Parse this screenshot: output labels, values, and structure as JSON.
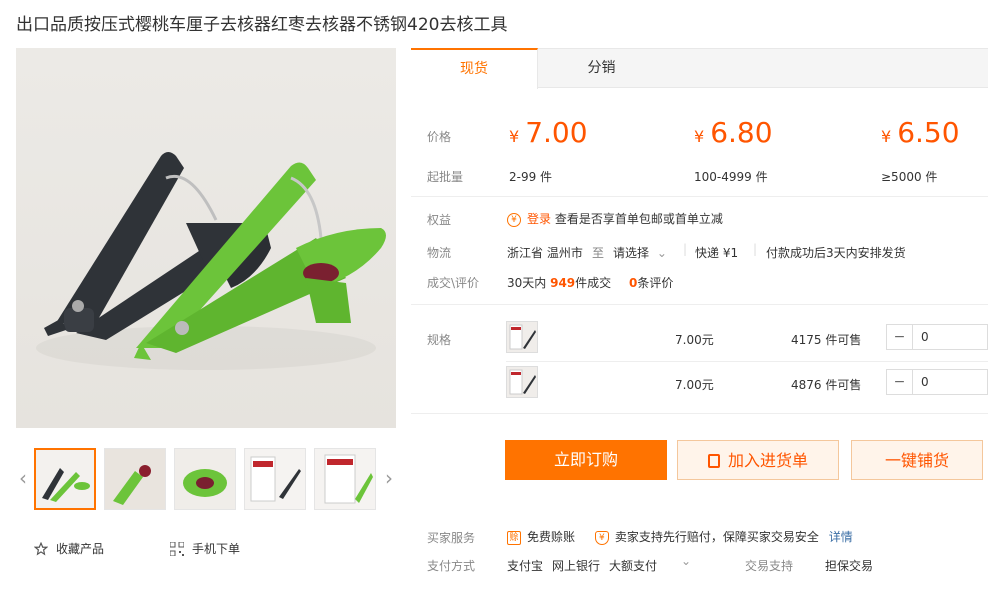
{
  "title": "出口品质按压式樱桃车厘子去核器红枣去核器不锈钢420去核工具",
  "gallery": {
    "prev_arrow": "‹",
    "next_arrow": "›",
    "thumb_count": 5,
    "collect_label": "收藏产品",
    "mobile_label": "手机下单"
  },
  "tabs": [
    {
      "label": "现货",
      "active": true
    },
    {
      "label": "分销",
      "active": false
    }
  ],
  "pricing": {
    "price_label": "价格",
    "moq_label": "起批量",
    "currency": "¥",
    "tiers": [
      {
        "price": "7.00",
        "range": "2-99 件"
      },
      {
        "price": "6.80",
        "range": "100-4999 件"
      },
      {
        "price": "6.50",
        "range": "≥5000 件"
      }
    ]
  },
  "benefits": {
    "label": "权益",
    "login": "登录",
    "text": "查看是否享首单包邮或首单立减"
  },
  "logistics": {
    "label": "物流",
    "origin": "浙江省 温州市",
    "to": "至",
    "dest_placeholder": "请选择",
    "express": "快递 ¥1",
    "ship_note": "付款成功后3天内安排发货"
  },
  "deals": {
    "label": "成交\\评价",
    "prefix": "30天内",
    "count": "949",
    "suffix": "件成交",
    "reviews_count": "0",
    "reviews_suffix": "条评价"
  },
  "specs": {
    "label": "规格",
    "rows": [
      {
        "price": "7.00元",
        "stock": "4175 件可售",
        "qty": "0"
      },
      {
        "price": "7.00元",
        "stock": "4876 件可售",
        "qty": "0"
      }
    ]
  },
  "buttons": {
    "buy": "立即订购",
    "add_cart": "加入进货单",
    "dist": "一键铺货"
  },
  "services": {
    "label": "买家服务",
    "free_refund": "免费赊账",
    "guarantee": "卖家支持先行赔付，保障买家交易安全",
    "detail": "详情"
  },
  "payment": {
    "label": "支付方式",
    "methods": [
      "支付宝",
      "网上银行",
      "大额支付"
    ],
    "trade_label": "交易支持",
    "trade_value": "担保交易"
  },
  "colors": {
    "accent": "#ff7300",
    "price": "#ff5500",
    "green_tool": "#6cc43a",
    "dark_tool": "#2f3338"
  }
}
